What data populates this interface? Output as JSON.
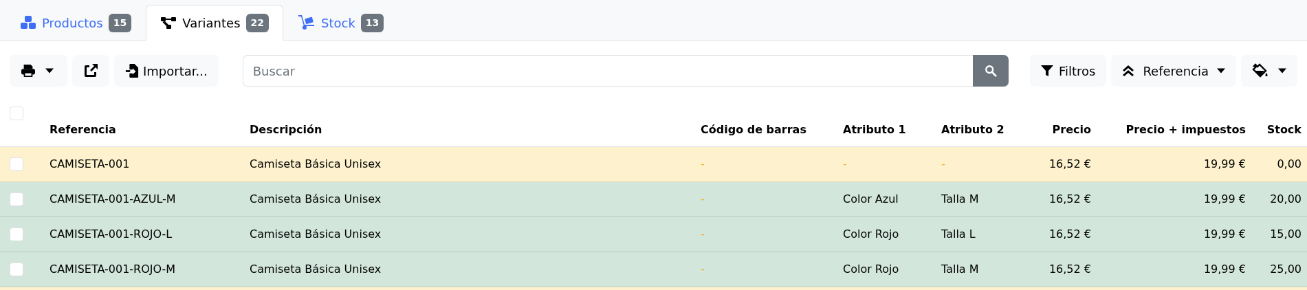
{
  "tabs": [
    {
      "kind": "cubes",
      "label": "Productos",
      "count": "15",
      "selected": false
    },
    {
      "kind": "diagram",
      "label": "Variantes",
      "count": "22",
      "selected": true
    },
    {
      "kind": "dolly",
      "label": "Stock",
      "count": "13",
      "selected": false
    }
  ],
  "toolbar": {
    "import_label": "Importar...",
    "search": {
      "placeholder": "Buscar"
    },
    "filters_label": "Filtros",
    "sort_label": "Referencia"
  },
  "table": {
    "columns": [
      {
        "label": "Referencia",
        "kind": "text"
      },
      {
        "label": "Descripción",
        "kind": "text"
      },
      {
        "label": "Código de barras",
        "kind": "text"
      },
      {
        "label": "Atributo 1",
        "kind": "text"
      },
      {
        "label": "Atributo 2",
        "kind": "text"
      },
      {
        "label": "Precio",
        "kind": "number"
      },
      {
        "label": "Precio + impuestos",
        "kind": "number"
      },
      {
        "label": "Stock",
        "kind": "number"
      }
    ],
    "all_checked": false,
    "rows": [
      {
        "kind": "warning",
        "checked": false,
        "cells": [
          {
            "text": "CAMISETA-001",
            "empty": false
          },
          {
            "text": "Camiseta Básica Unisex",
            "empty": false
          },
          {
            "text": "-",
            "empty": true
          },
          {
            "text": "-",
            "empty": true
          },
          {
            "text": "-",
            "empty": true
          },
          {
            "text": "16,52 €",
            "empty": false
          },
          {
            "text": "19,99 €",
            "empty": false
          },
          {
            "text": "0,00",
            "empty": false
          }
        ]
      },
      {
        "kind": "success",
        "checked": false,
        "cells": [
          {
            "text": "CAMISETA-001-AZUL-M",
            "empty": false
          },
          {
            "text": "Camiseta Básica Unisex",
            "empty": false
          },
          {
            "text": "-",
            "empty": true
          },
          {
            "text": "Color Azul",
            "empty": false
          },
          {
            "text": "Talla M",
            "empty": false
          },
          {
            "text": "16,52 €",
            "empty": false
          },
          {
            "text": "19,99 €",
            "empty": false
          },
          {
            "text": "20,00",
            "empty": false
          }
        ]
      },
      {
        "kind": "success",
        "checked": false,
        "cells": [
          {
            "text": "CAMISETA-001-ROJO-L",
            "empty": false
          },
          {
            "text": "Camiseta Básica Unisex",
            "empty": false
          },
          {
            "text": "-",
            "empty": true
          },
          {
            "text": "Color Rojo",
            "empty": false
          },
          {
            "text": "Talla L",
            "empty": false
          },
          {
            "text": "16,52 €",
            "empty": false
          },
          {
            "text": "19,99 €",
            "empty": false
          },
          {
            "text": "15,00",
            "empty": false
          }
        ]
      },
      {
        "kind": "success",
        "checked": false,
        "cells": [
          {
            "text": "CAMISETA-001-ROJO-M",
            "empty": false
          },
          {
            "text": "Camiseta Básica Unisex",
            "empty": false
          },
          {
            "text": "-",
            "empty": true
          },
          {
            "text": "Color Rojo",
            "empty": false
          },
          {
            "text": "Talla M",
            "empty": false
          },
          {
            "text": "16,52 €",
            "empty": false
          },
          {
            "text": "19,99 €",
            "empty": false
          },
          {
            "text": "25,00",
            "empty": false
          }
        ]
      }
    ]
  }
}
